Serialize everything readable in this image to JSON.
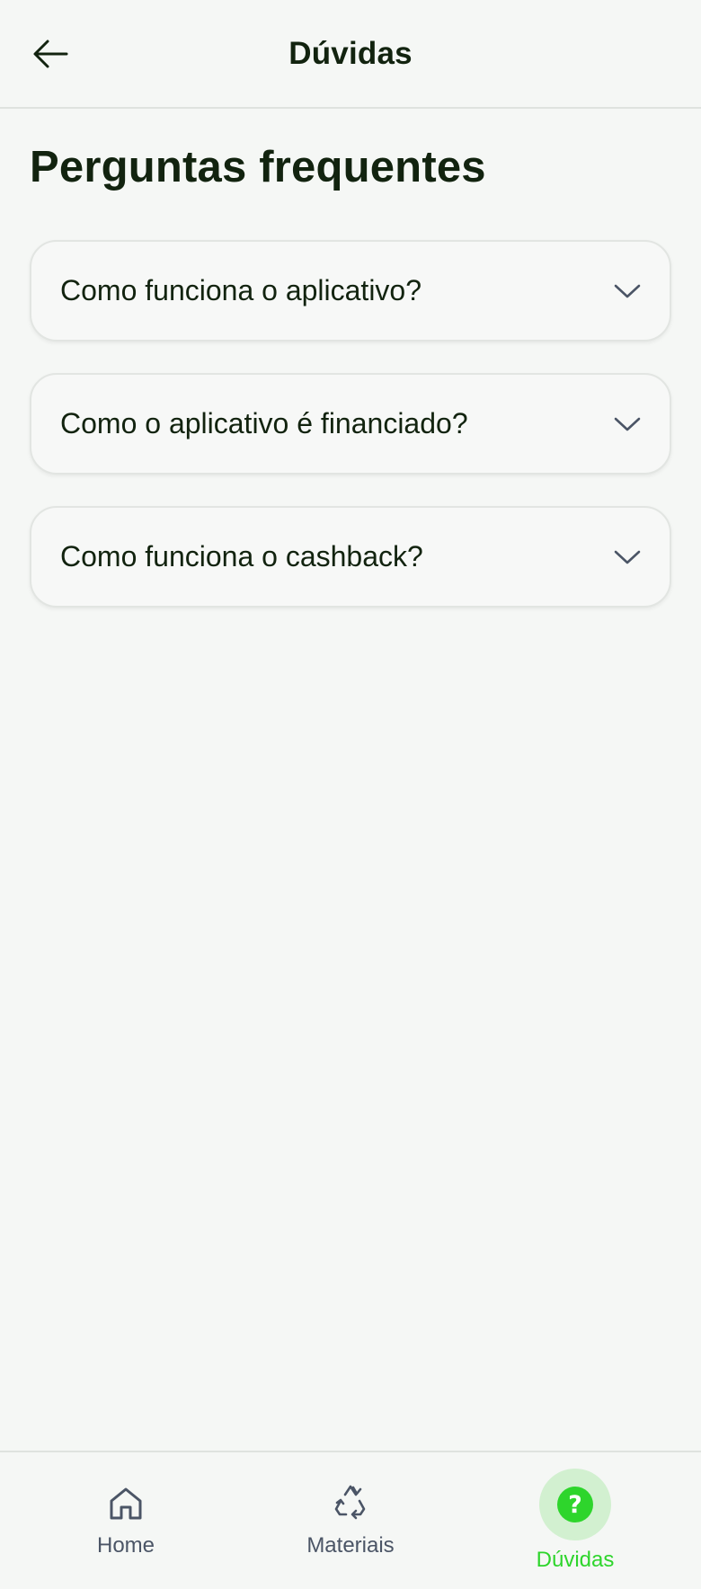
{
  "header": {
    "title": "Dúvidas",
    "back_icon": "arrow-left-icon"
  },
  "main": {
    "section_title": "Perguntas frequentes",
    "faq": [
      {
        "question": "Como funciona o aplicativo?",
        "icon": "chevron-down-icon"
      },
      {
        "question": "Como o aplicativo é financiado?",
        "icon": "chevron-down-icon"
      },
      {
        "question": "Como funciona o cashback?",
        "icon": "chevron-down-icon"
      }
    ]
  },
  "bottom_nav": {
    "items": [
      {
        "label": "Home",
        "icon": "home-icon",
        "active": false
      },
      {
        "label": "Materiais",
        "icon": "recycle-icon",
        "active": false
      },
      {
        "label": "Dúvidas",
        "icon": "help-circle-icon",
        "active": true
      }
    ]
  },
  "colors": {
    "background": "#f5f7f5",
    "text_primary": "#12230f",
    "accent_green": "#2ed52c",
    "accent_green_light": "#d2f0d0",
    "nav_inactive": "#4b5566"
  }
}
